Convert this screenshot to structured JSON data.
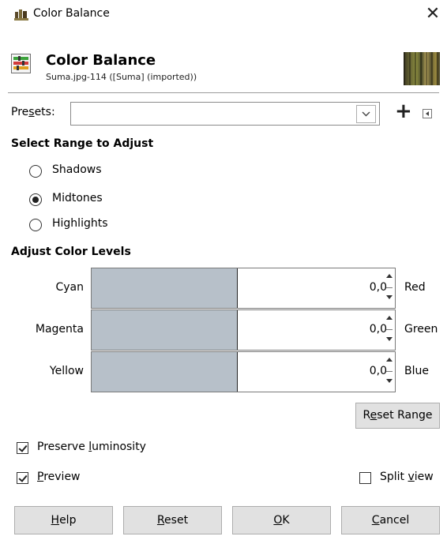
{
  "window": {
    "title": "Color Balance",
    "close_symbol": "✕"
  },
  "header": {
    "title": "Color Balance",
    "subtitle": "Suma.jpg-114 ([Suma] (imported))"
  },
  "presets": {
    "label_pre": "Pre",
    "label_u": "s",
    "label_post": "ets:",
    "value": "",
    "add_symbol": "+"
  },
  "range": {
    "heading": "Select Range to Adjust",
    "options": [
      {
        "label": "Shadows",
        "selected": false
      },
      {
        "label": "Midtones",
        "selected": true
      },
      {
        "label": "Highlights",
        "selected": false
      }
    ]
  },
  "levels": {
    "heading": "Adjust Color Levels",
    "sliders": [
      {
        "left": "Cyan",
        "right": "Red",
        "value": "0,0",
        "position": 0.5
      },
      {
        "left": "Magenta",
        "right": "Green",
        "value": "0,0",
        "position": 0.5
      },
      {
        "left": "Yellow",
        "right": "Blue",
        "value": "0,0",
        "position": 0.5
      }
    ],
    "reset_range_pre": "R",
    "reset_range_u": "e",
    "reset_range_post": "set Range"
  },
  "options": {
    "preserve_pre": "Preserve ",
    "preserve_u": "l",
    "preserve_post": "uminosity",
    "preserve_checked": true,
    "preview_u": "P",
    "preview_post": "review",
    "preview_checked": true,
    "split_pre": "Split ",
    "split_u": "v",
    "split_post": "iew",
    "split_checked": false
  },
  "buttons": {
    "help_u": "H",
    "help_post": "elp",
    "reset_u": "R",
    "reset_post": "eset",
    "ok_u": "O",
    "ok_post": "K",
    "cancel_u": "C",
    "cancel_post": "ancel"
  }
}
